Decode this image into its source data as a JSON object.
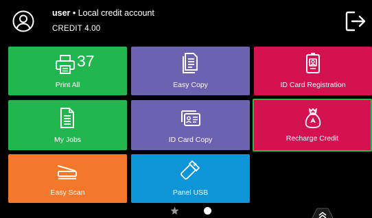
{
  "header": {
    "user_name": "user",
    "separator": " • ",
    "account_type": "Local credit account",
    "credit": "CREDIT 4.00",
    "avatar_icon": "user-circle-icon",
    "logout_icon": "logout-icon"
  },
  "tiles": [
    {
      "label": "Print All",
      "icon": "printer-icon",
      "badge": "37",
      "color": "#22b74e"
    },
    {
      "label": "Easy Copy",
      "icon": "copy-document-icon",
      "color": "#6b62b0"
    },
    {
      "label": "ID Card Registration",
      "icon": "id-badge-icon",
      "color": "#d31251"
    },
    {
      "label": "My Jobs",
      "icon": "document-list-icon",
      "color": "#22b74e"
    },
    {
      "label": "ID Card Copy",
      "icon": "id-card-copy-icon",
      "color": "#6b62b0"
    },
    {
      "label": "Recharge Credit",
      "icon": "money-bag-icon",
      "color": "#d31251",
      "selected": true
    },
    {
      "label": "Easy Scan",
      "icon": "scanner-icon",
      "color": "#f3782b"
    },
    {
      "label": "Panel USB",
      "icon": "usb-icon",
      "color": "#0d95d8"
    }
  ],
  "pager": {
    "pages": [
      "favorites",
      "home"
    ],
    "active": "home",
    "star_icon": "star-icon",
    "expand_icon": "chevron-up-double-icon"
  }
}
